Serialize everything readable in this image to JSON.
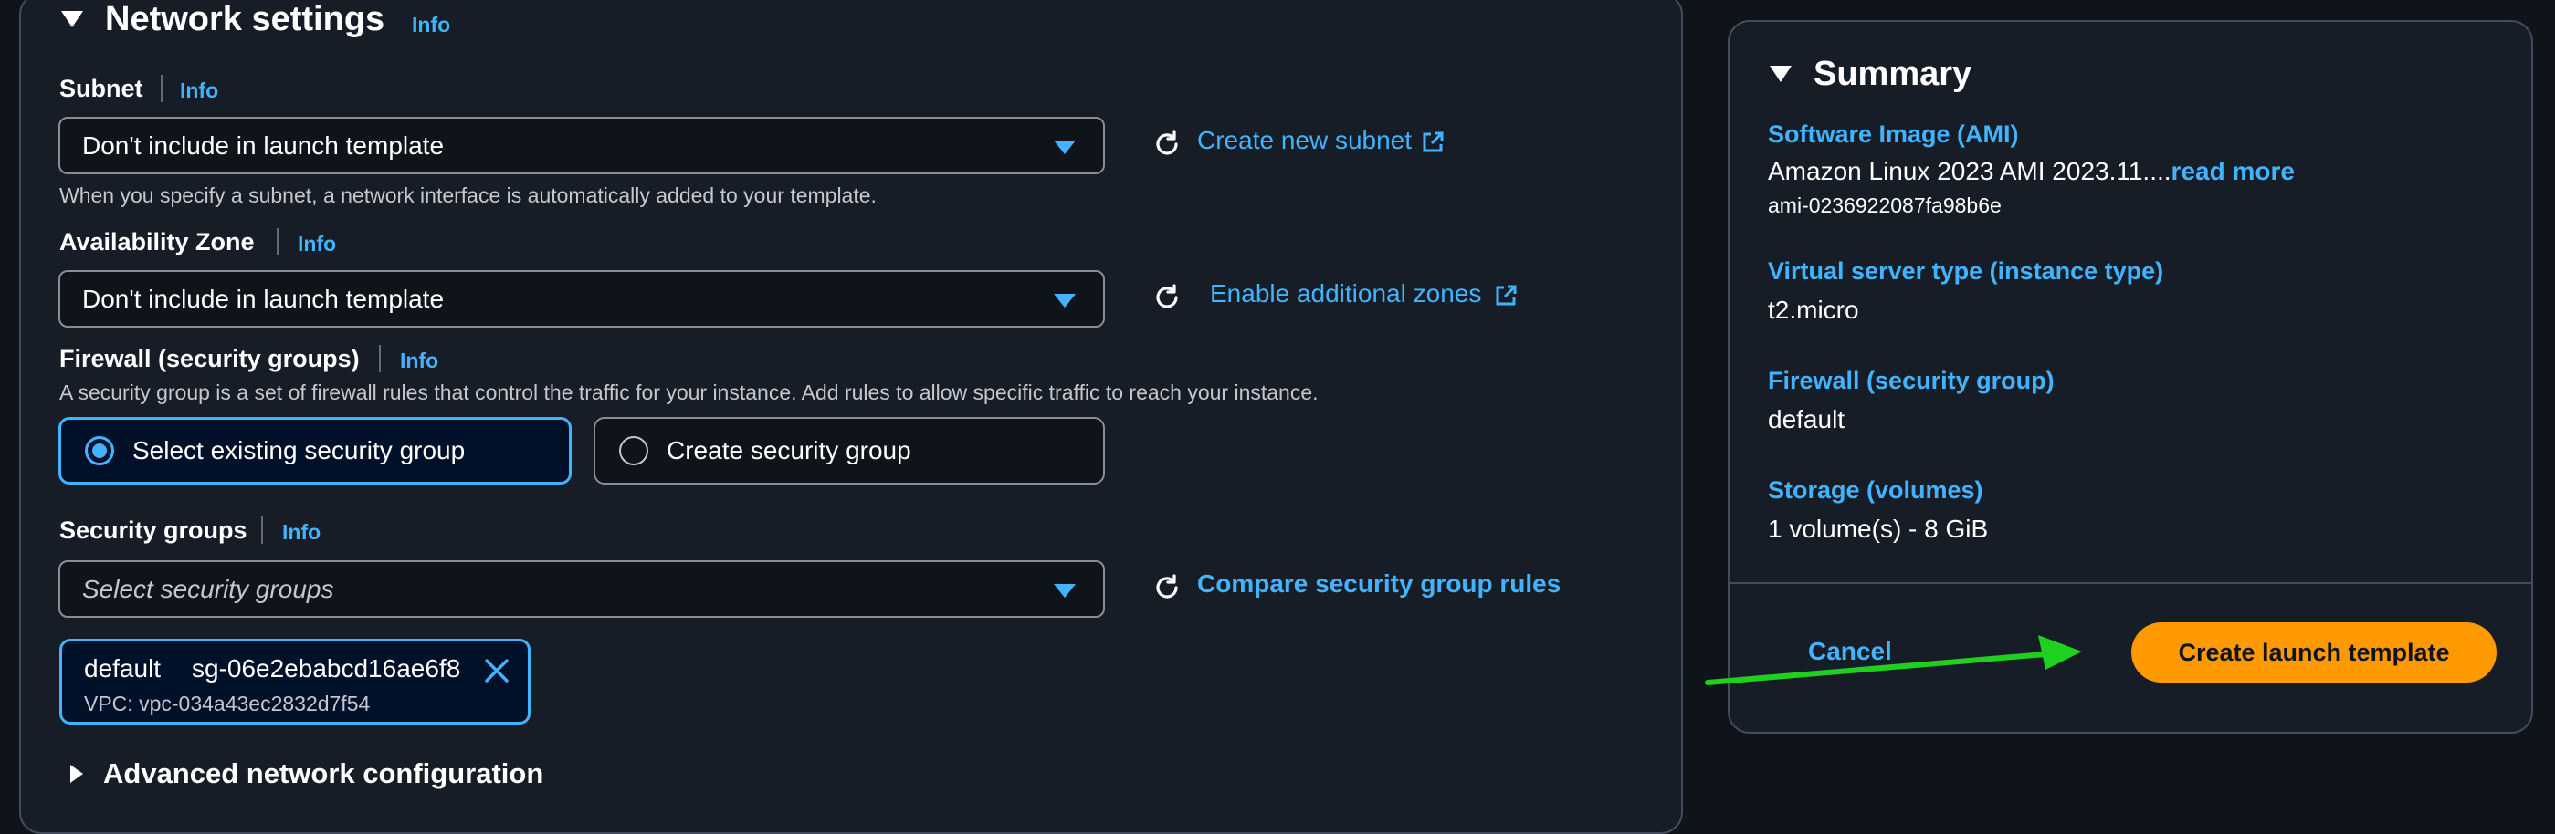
{
  "network": {
    "title": "Network settings",
    "info": "Info",
    "subnet": {
      "label": "Subnet",
      "info": "Info",
      "value": "Don't include in launch template",
      "hint": "When you specify a subnet, a network interface is automatically added to your template.",
      "link": "Create new subnet"
    },
    "az": {
      "label": "Availability Zone",
      "info": "Info",
      "value": "Don't include in launch template",
      "link": "Enable additional zones"
    },
    "firewall": {
      "label": "Firewall (security groups)",
      "info": "Info",
      "hint": "A security group is a set of firewall rules that control the traffic for your instance. Add rules to allow specific traffic to reach your instance.",
      "option_existing": "Select existing security group",
      "option_create": "Create security group"
    },
    "sg": {
      "label": "Security groups",
      "info": "Info",
      "placeholder": "Select security groups",
      "link": "Compare security group rules",
      "token_name": "default",
      "token_id": "sg-06e2ebabcd16ae6f8",
      "token_vpc": "VPC: vpc-034a43ec2832d7f54"
    },
    "advanced": "Advanced network configuration"
  },
  "summary": {
    "title": "Summary",
    "ami_label": "Software Image (AMI)",
    "ami_value": "Amazon Linux 2023 AMI 2023.11....",
    "ami_read_more": "read more",
    "ami_id": "ami-0236922087fa98b6e",
    "instance_label": "Virtual server type (instance type)",
    "instance_value": "t2.micro",
    "firewall_label": "Firewall (security group)",
    "firewall_value": "default",
    "storage_label": "Storage (volumes)",
    "storage_value": "1 volume(s) - 8 GiB",
    "cancel": "Cancel",
    "create": "Create launch template"
  },
  "colors": {
    "link": "#42b4ff",
    "primary": "#ff9900",
    "arrow": "#1fd01f"
  }
}
